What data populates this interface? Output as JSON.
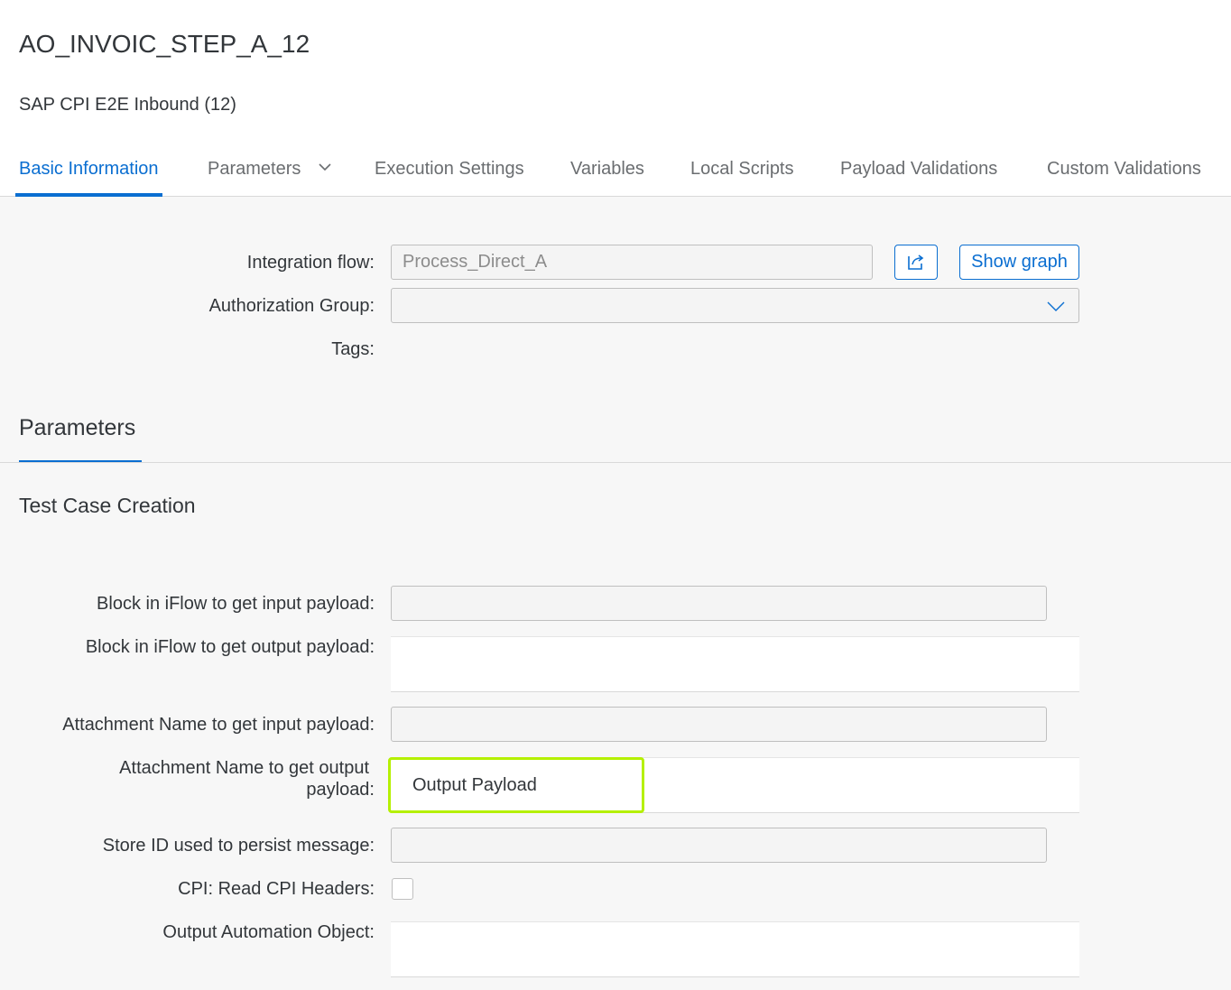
{
  "header": {
    "title": "AO_INVOIC_STEP_A_12",
    "subtitle": "SAP CPI E2E Inbound (12)"
  },
  "tabs": [
    {
      "label": "Basic Information",
      "active": true
    },
    {
      "label": "Parameters",
      "has_dropdown": true
    },
    {
      "label": "Execution Settings"
    },
    {
      "label": "Variables"
    },
    {
      "label": "Local Scripts"
    },
    {
      "label": "Payload Validations"
    },
    {
      "label": "Custom Validations"
    }
  ],
  "basic": {
    "integration_flow_label": "Integration flow:",
    "integration_flow_value": "Process_Direct_A",
    "open_icon": "external-link-icon",
    "show_graph_label": "Show graph",
    "authorization_group_label": "Authorization Group:",
    "authorization_group_value": "",
    "tags_label": "Tags:"
  },
  "parameters": {
    "section_title": "Parameters",
    "subsection_title": "Test Case Creation",
    "block_input_label": "Block in iFlow to get input payload:",
    "block_input_value": "",
    "block_output_label": "Block in iFlow to get output payload:",
    "attachment_input_label": "Attachment Name to get input payload:",
    "attachment_input_value": "",
    "attachment_output_label_line1": "Attachment Name to get output",
    "attachment_output_label_line2": "payload:",
    "attachment_output_value": "Output Payload",
    "store_id_label": "Store ID used to persist message:",
    "store_id_value": "",
    "read_headers_label": "CPI: Read CPI Headers:",
    "read_headers_checked": false,
    "output_automation_label": "Output Automation Object:"
  },
  "colors": {
    "accent": "#0a6ed1",
    "highlight": "#b5f000",
    "text": "#32363a"
  }
}
